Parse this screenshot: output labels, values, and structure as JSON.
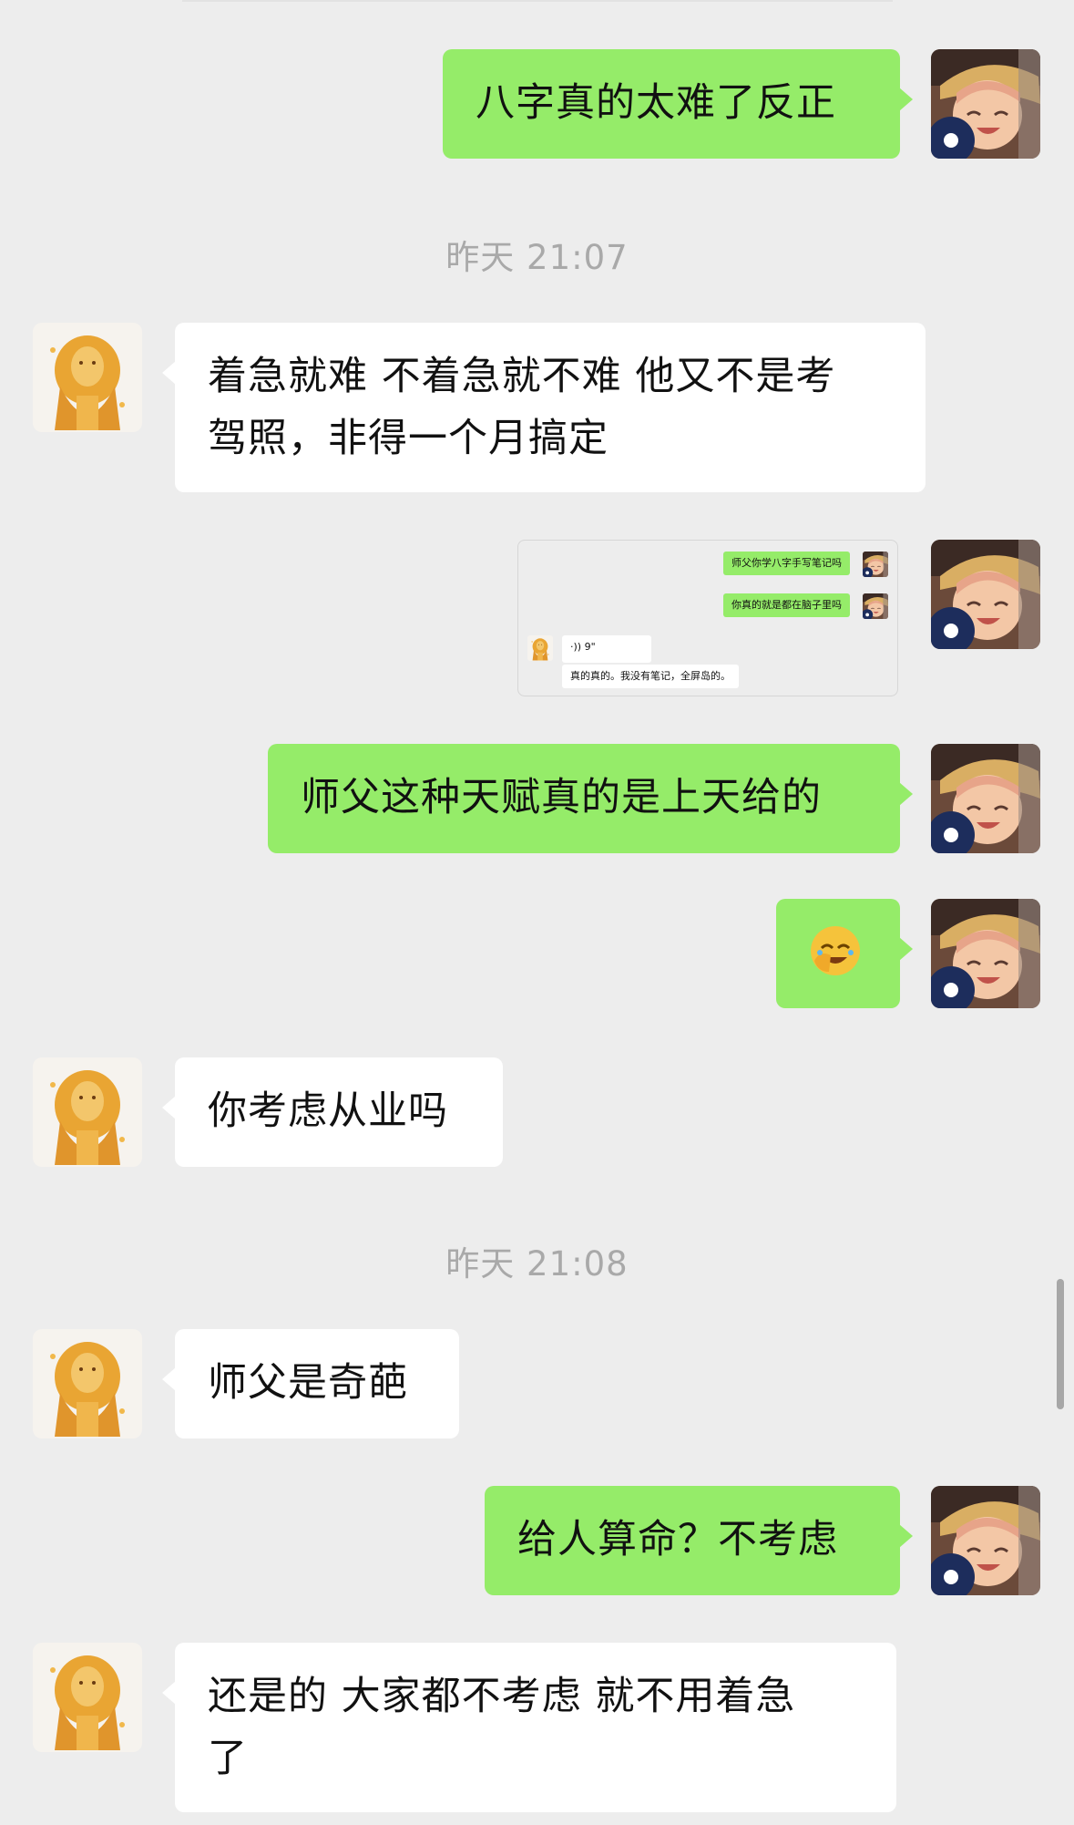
{
  "timestamps": [
    "昨天 21:07",
    "昨天 21:08"
  ],
  "messages": {
    "m1": "八字真的太难了反正",
    "m2_line1": "着急就难 不着急就不难  他又不是考",
    "m2_line2": "驾照，非得一个月搞定",
    "m4": "师父这种天赋真的是上天给的",
    "m6": "你考虑从业吗",
    "m7": "师父是奇葩",
    "m8": "给人算命？不考虑",
    "m9_line1": "还是的  大家都不考虑  就不用着急",
    "m9_line2": "了"
  },
  "screenshot": {
    "bubble1": "师父你学八字手写笔记吗",
    "bubble2": "你真的就是都在脑子里吗",
    "voice": "9\"",
    "reply": "真的真的。我没有笔记，全屏岛的。"
  },
  "icons": {
    "self_avatar": "anime-girl-avatar",
    "other_avatar": "lion-avatar",
    "emoji": "facepalm-laugh-emoji",
    "voice": "voice-wave-icon"
  },
  "colors": {
    "background": "#ededed",
    "outgoing_bubble": "#95ec69",
    "incoming_bubble": "#ffffff",
    "timestamp_text": "#a9a9a9"
  }
}
